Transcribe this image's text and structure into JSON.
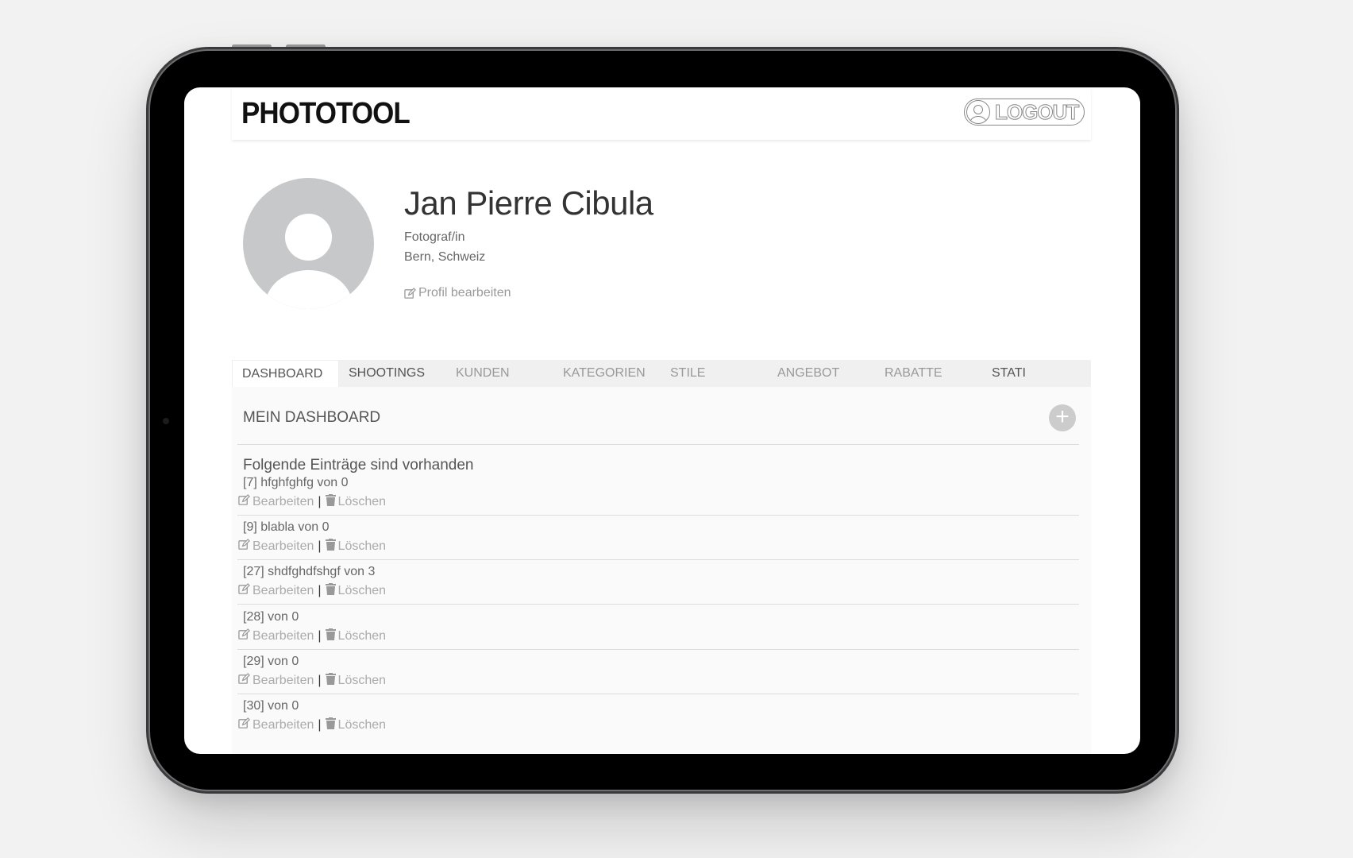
{
  "app": {
    "logo": "PHOTOTOOL",
    "logout_label": "LOGOUT"
  },
  "profile": {
    "name": "Jan Pierre Cibula",
    "role": "Fotograf/in",
    "location": "Bern, Schweiz",
    "edit_label": "Profil bearbeiten"
  },
  "tabs": [
    {
      "label": "DASHBOARD",
      "active": true
    },
    {
      "label": "SHOOTINGS"
    },
    {
      "label": "KUNDEN"
    },
    {
      "label": "KATEGORIEN"
    },
    {
      "label": "STILE"
    },
    {
      "label": "ANGEBOT"
    },
    {
      "label": "RABATTE"
    },
    {
      "label": "STATI"
    }
  ],
  "dashboard": {
    "title": "MEIN DASHBOARD",
    "entries_heading": "Folgende Einträge sind vorhanden",
    "edit_label": "Bearbeiten",
    "separator": "|",
    "delete_label": "Löschen",
    "entries": [
      {
        "title": "[7] hfghfghfg von 0"
      },
      {
        "title": "[9] blabla von 0"
      },
      {
        "title": "[27] shdfghdfshgf von 3"
      },
      {
        "title": "[28] von 0"
      },
      {
        "title": "[29] von 0"
      },
      {
        "title": "[30] von 0"
      }
    ]
  }
}
